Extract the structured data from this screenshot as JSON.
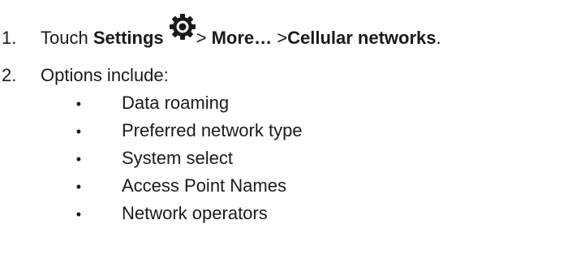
{
  "steps": [
    {
      "number": "1.",
      "prefix": "Touch ",
      "settings": "Settings",
      "settings_icon": "gear-icon",
      "sep1": "> ",
      "more": "More…",
      "sep2": " >",
      "cellular": "Cellular networks",
      "end": "."
    },
    {
      "number": "2.",
      "text": "Options include:"
    }
  ],
  "bullet_glyph": "•",
  "options": [
    "Data roaming",
    "Preferred network type",
    "System select",
    "Access Point Names",
    "Network operators"
  ]
}
